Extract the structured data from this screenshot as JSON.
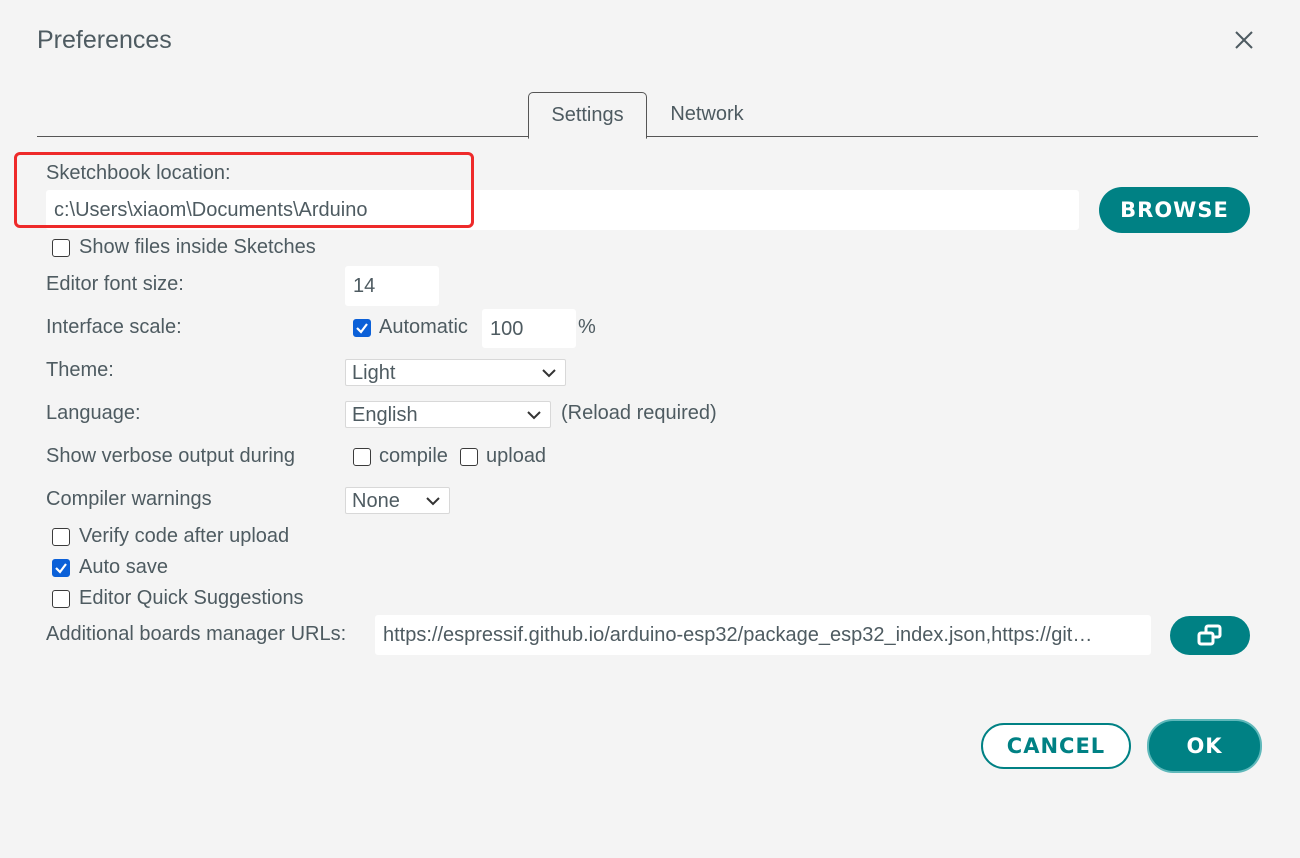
{
  "dialog": {
    "title": "Preferences"
  },
  "tabs": [
    {
      "label": "Settings",
      "active": true
    },
    {
      "label": "Network",
      "active": false
    }
  ],
  "sketchbook": {
    "label": "Sketchbook location:",
    "path": "c:\\Users\\xiaom\\Documents\\Arduino",
    "browse_label": "BROWSE",
    "show_files_label": "Show files inside Sketches",
    "show_files_checked": false
  },
  "editor_font": {
    "label": "Editor font size:",
    "value": "14"
  },
  "interface_scale": {
    "label": "Interface scale:",
    "automatic_label": "Automatic",
    "automatic_checked": true,
    "value": "100",
    "unit": "%"
  },
  "theme": {
    "label": "Theme:",
    "selected": "Light"
  },
  "language": {
    "label": "Language:",
    "selected": "English",
    "note": "(Reload required)"
  },
  "verbose": {
    "label": "Show verbose output during",
    "compile_label": "compile",
    "compile_checked": false,
    "upload_label": "upload",
    "upload_checked": false
  },
  "compiler_warnings": {
    "label": "Compiler warnings",
    "selected": "None"
  },
  "options": {
    "verify_label": "Verify code after upload",
    "verify_checked": false,
    "autosave_label": "Auto save",
    "autosave_checked": true,
    "quick_suggestions_label": "Editor Quick Suggestions",
    "quick_suggestions_checked": false
  },
  "boards_urls": {
    "label": "Additional boards manager URLs:",
    "value": "https://espressif.github.io/arduino-esp32/package_esp32_index.json,https://git…"
  },
  "footer": {
    "cancel_label": "CANCEL",
    "ok_label": "OK"
  },
  "colors": {
    "accent": "#008184",
    "highlight_box": "#ee2a2a",
    "checkbox_checked": "#0b60d8"
  },
  "icons": {
    "close": "close-icon",
    "expand": "open-window-icon",
    "dropdown": "chevron-down-icon",
    "check": "checkmark-icon"
  }
}
